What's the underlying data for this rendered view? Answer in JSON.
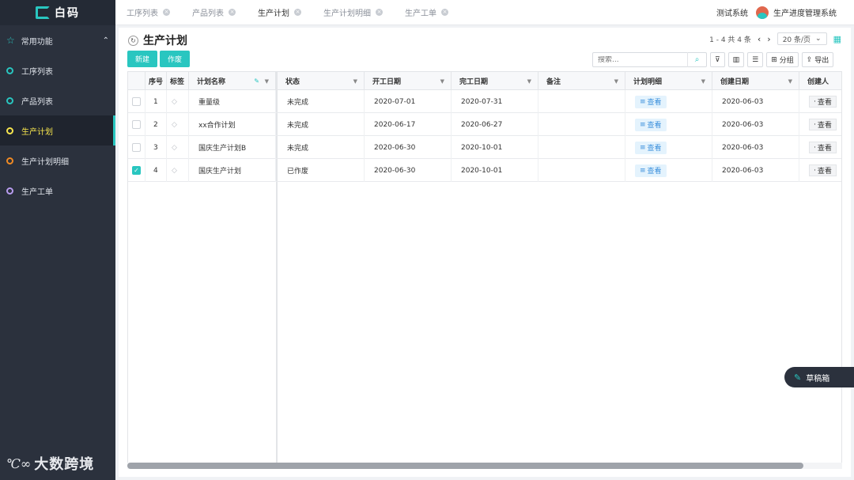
{
  "app": {
    "logo_text": "白码"
  },
  "sidebar": {
    "group_label": "常用功能",
    "items": [
      {
        "label": "工序列表",
        "dot_color": "#29c6c0"
      },
      {
        "label": "产品列表",
        "dot_color": "#29c6c0"
      },
      {
        "label": "生产计划",
        "dot_color": "#f6e54e",
        "active": true
      },
      {
        "label": "生产计划明细",
        "dot_color": "#f08a24"
      },
      {
        "label": "生产工单",
        "dot_color": "#b89cf0"
      }
    ],
    "watermark_mark": "℃∞",
    "watermark_text": "大数跨境"
  },
  "tabs": [
    {
      "label": "工序列表"
    },
    {
      "label": "产品列表"
    },
    {
      "label": "生产计划",
      "active": true
    },
    {
      "label": "生产计划明细"
    },
    {
      "label": "生产工单"
    }
  ],
  "header": {
    "system_label": "测试系统",
    "user_name": "生产进度管理系统"
  },
  "page": {
    "title": "生产计划",
    "pager_text": "1 - 4  共 4 条",
    "page_size": "20 条/页",
    "new_button": "新建",
    "void_button": "作废",
    "search_placeholder": "搜索...",
    "group_button": "分组",
    "export_button": "导出"
  },
  "table": {
    "headers": {
      "index": "序号",
      "tag": "标签",
      "name": "计划名称",
      "status": "状态",
      "start": "开工日期",
      "end": "完工日期",
      "remark": "备注",
      "detail": "计划明细",
      "created": "创建日期",
      "creator": "创建人"
    },
    "rows": [
      {
        "checked": false,
        "index": "1",
        "name": "重量级",
        "status": "未完成",
        "start": "2020-07-01",
        "end": "2020-07-31",
        "remark": "",
        "detail": "查看",
        "created": "2020-06-03",
        "creator": "查看"
      },
      {
        "checked": false,
        "index": "2",
        "name": "xx合作计划",
        "status": "未完成",
        "start": "2020-06-17",
        "end": "2020-06-27",
        "remark": "",
        "detail": "查看",
        "created": "2020-06-03",
        "creator": "查看"
      },
      {
        "checked": false,
        "index": "3",
        "name": "国庆生产计划B",
        "status": "未完成",
        "start": "2020-06-30",
        "end": "2020-10-01",
        "remark": "",
        "detail": "查看",
        "created": "2020-06-03",
        "creator": "查看"
      },
      {
        "checked": true,
        "index": "4",
        "name": "国庆生产计划",
        "status": "已作废",
        "start": "2020-06-30",
        "end": "2020-10-01",
        "remark": "",
        "detail": "查看",
        "created": "2020-06-03",
        "creator": "查看"
      }
    ]
  },
  "draft": {
    "label": "草稿箱"
  },
  "colors": {
    "accent": "#29c6c0",
    "sidebar_bg": "#2b313d",
    "active_text": "#f6e54e",
    "link_blue": "#3a8fdc"
  }
}
